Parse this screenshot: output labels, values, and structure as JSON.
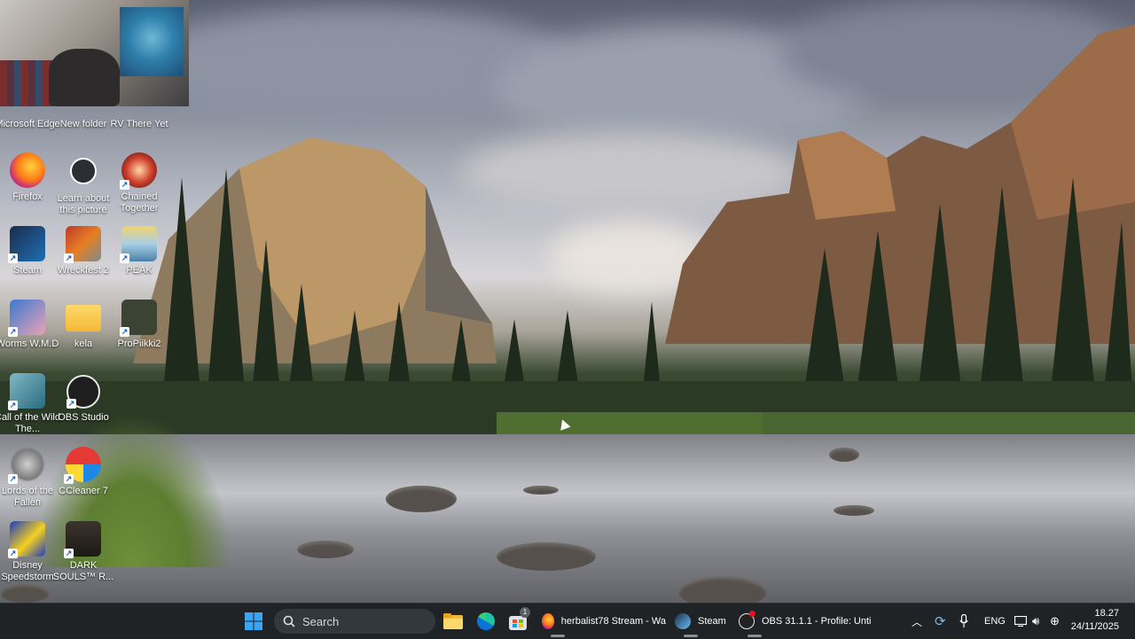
{
  "desktop": {
    "icons": [
      {
        "label": "Microsoft Edge",
        "icon": "edge-icon",
        "shortcut": false
      },
      {
        "label": "New folder",
        "icon": "folder-icon",
        "shortcut": false
      },
      {
        "label": "RV There Yet",
        "icon": "game-icon",
        "shortcut": true
      },
      {
        "label": "Firefox",
        "icon": "firefox-icon",
        "shortcut": false
      },
      {
        "label": "Learn about this picture",
        "icon": "camera-icon",
        "shortcut": false
      },
      {
        "label": "Chained Together",
        "icon": "game-icon",
        "shortcut": true
      },
      {
        "label": "Steam",
        "icon": "steam-icon",
        "shortcut": true
      },
      {
        "label": "Wreckfest 2",
        "icon": "game-icon",
        "shortcut": true
      },
      {
        "label": "PEAK",
        "icon": "game-icon",
        "shortcut": true
      },
      {
        "label": "Worms W.M.D",
        "icon": "game-icon",
        "shortcut": true
      },
      {
        "label": "kela",
        "icon": "folder-icon",
        "shortcut": false
      },
      {
        "label": "ProPiikki2",
        "icon": "game-icon",
        "shortcut": true
      },
      {
        "label": "Call of the Wild The...",
        "icon": "game-icon",
        "shortcut": true
      },
      {
        "label": "OBS Studio",
        "icon": "obs-icon",
        "shortcut": true
      },
      {
        "label": "Lords of the Fallen",
        "icon": "game-icon",
        "shortcut": true
      },
      {
        "label": "CCleaner 7",
        "icon": "ccleaner-icon",
        "shortcut": true
      },
      {
        "label": "Disney Speedstorm",
        "icon": "game-icon",
        "shortcut": true
      },
      {
        "label": "DARK SOULS™ R...",
        "icon": "game-icon",
        "shortcut": true
      }
    ]
  },
  "taskbar": {
    "search_placeholder": "Search",
    "apps": [
      {
        "label": "herbalist78 Stream - Wa",
        "icon": "firefox-icon"
      },
      {
        "label": "Steam",
        "icon": "steam-icon"
      },
      {
        "label": "OBS 31.1.1 - Profile: Unti",
        "icon": "obs-icon"
      }
    ],
    "store_badge": "1",
    "language": "ENG",
    "time": "18.27",
    "date": "24/11/2025"
  },
  "colors": {
    "taskbar_bg": "#1f2326",
    "windows_accent": "#3ba4f5"
  }
}
